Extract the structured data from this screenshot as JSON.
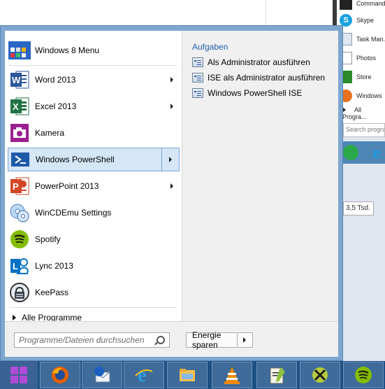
{
  "background_panel": {
    "items": [
      "Command...",
      "Skype",
      "Task Man...",
      "Photos",
      "Store",
      "Windows"
    ],
    "all_programs": "All Progra...",
    "search_placeholder": "Search progra...",
    "tooltip": "3,5 Tsd."
  },
  "start_menu": {
    "pinned": [
      {
        "label": "Windows 8 Menu",
        "icon": "windows8-menu-icon"
      },
      {
        "label": "Word 2013",
        "icon": "word-icon",
        "submenu": true
      },
      {
        "label": "Excel 2013",
        "icon": "excel-icon",
        "submenu": true
      },
      {
        "label": "Kamera",
        "icon": "camera-icon"
      },
      {
        "label": "Windows PowerShell",
        "icon": "powershell-icon",
        "submenu": true,
        "selected": true
      },
      {
        "label": "PowerPoint 2013",
        "icon": "powerpoint-icon",
        "submenu": true
      },
      {
        "label": "WinCDEmu Settings",
        "icon": "wincdemu-icon"
      },
      {
        "label": "Spotify",
        "icon": "spotify-icon"
      },
      {
        "label": "Lync 2013",
        "icon": "lync-icon"
      },
      {
        "label": "KeePass",
        "icon": "keepass-icon"
      }
    ],
    "all_programs": "Alle Programme",
    "tasks": {
      "title": "Aufgaben",
      "items": [
        "Als Administrator ausführen",
        "ISE als Administrator ausführen",
        "Windows PowerShell ISE"
      ]
    },
    "search_placeholder": "Programme/Dateien durchsuchen",
    "power_label": "Energie sparen"
  },
  "taskbar": {
    "buttons": [
      "firefox-icon",
      "thunderbird-icon",
      "internet-explorer-icon",
      "file-explorer-icon",
      "vlc-icon",
      "notepad-plus-icon",
      "xmind-icon",
      "spotify-icon"
    ]
  },
  "colors": {
    "frame": "#7ea7cf",
    "selection": "#d5e6f7",
    "taskbar": "#1d4f84",
    "task_title": "#1f5fa8"
  }
}
